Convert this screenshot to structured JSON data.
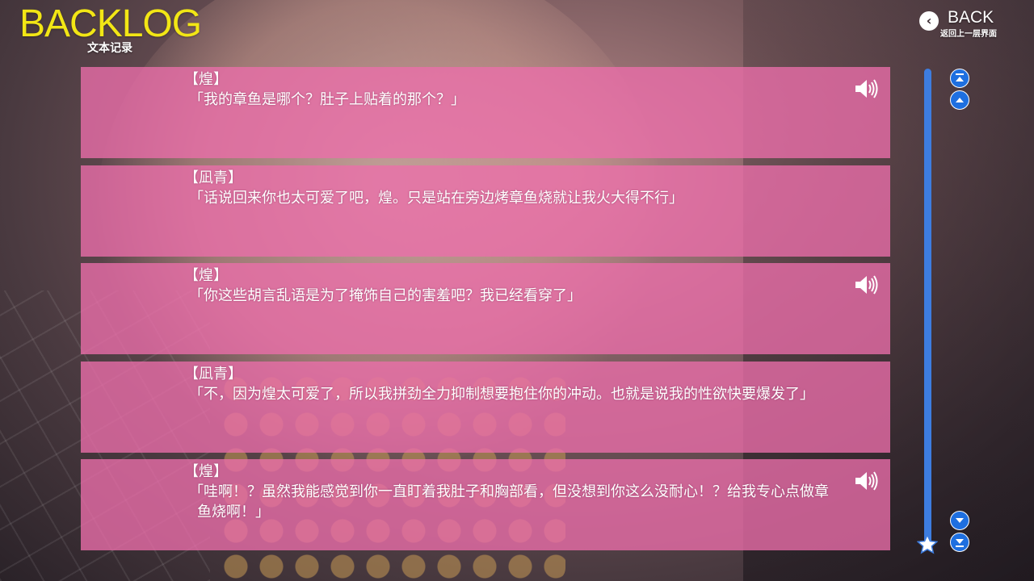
{
  "header": {
    "title": "BACKLOG",
    "subtitle": "文本记录",
    "back_label": "BACK",
    "back_sub": "返回上一层界面",
    "back_icon": "chevron-left-icon"
  },
  "entries": [
    {
      "speaker": "【煌】",
      "text": "「我的章鱼是哪个？肚子上贴着的那个？」",
      "has_voice": true
    },
    {
      "speaker": "【凪青】",
      "text": "「话说回来你也太可爱了吧，煌。只是站在旁边烤章鱼烧就让我火大得不行」",
      "has_voice": false
    },
    {
      "speaker": "【煌】",
      "text": "「你这些胡言乱语是为了掩饰自己的害羞吧？我已经看穿了」",
      "has_voice": true
    },
    {
      "speaker": "【凪青】",
      "text": "「不，因为煌太可爱了，所以我拼劲全力抑制想要抱住你的冲动。也就是说我的性欲快要爆发了」",
      "has_voice": false
    },
    {
      "speaker": "【煌】",
      "text": "「哇啊！？虽然我能感觉到你一直盯着我肚子和胸部看，但没想到你这么没耐心！？给我专心点做章鱼烧啊！」",
      "has_voice": true
    }
  ],
  "icons": {
    "voice": "speaker-icon",
    "scroll_top": "double-chevron-up-icon",
    "scroll_up": "chevron-up-icon",
    "scroll_down": "chevron-down-icon",
    "scroll_bottom": "double-chevron-down-icon",
    "thumb": "star-icon"
  },
  "colors": {
    "title": "#f2e615",
    "entry_bg": "#ec6eaa",
    "scrollbar": "#3d7de0",
    "nav_button": "#1e6fe0"
  },
  "scroll_position": 1.0
}
